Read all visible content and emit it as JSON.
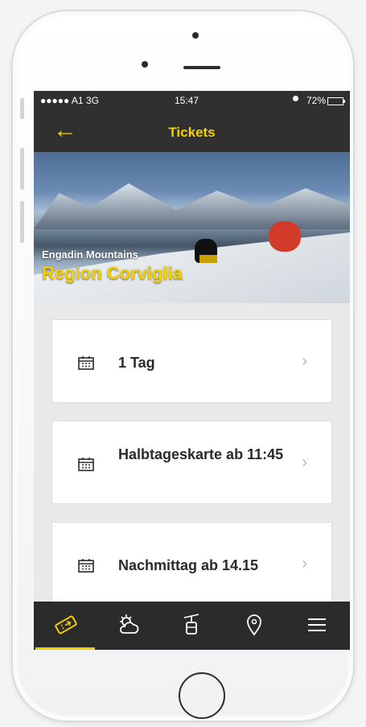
{
  "statusbar": {
    "carrier": "●●●●● A1  3G",
    "time": "15:47",
    "battery": "72%",
    "battery_level": 0.72
  },
  "navbar": {
    "back_icon": "back-arrow-icon",
    "title": "Tickets"
  },
  "hero": {
    "subtitle": "Engadin Mountains",
    "title": "Region Corviglia"
  },
  "tickets": [
    {
      "label": "1 Tag",
      "icon": "calendar-icon"
    },
    {
      "label": "Halbtageskarte ab 11:45",
      "icon": "calendar-icon"
    },
    {
      "label": "Nachmittag ab 14.15",
      "icon": "calendar-icon"
    }
  ],
  "tabbar": {
    "items": [
      {
        "icon": "ticket-icon",
        "active": true
      },
      {
        "icon": "weather-icon",
        "active": false
      },
      {
        "icon": "cable-car-icon",
        "active": false
      },
      {
        "icon": "location-pin-icon",
        "active": false
      },
      {
        "icon": "menu-icon",
        "active": false
      }
    ]
  },
  "colors": {
    "accent": "#f5d000",
    "bar": "#303030",
    "card": "#ffffff",
    "background": "#e9e9ea"
  }
}
